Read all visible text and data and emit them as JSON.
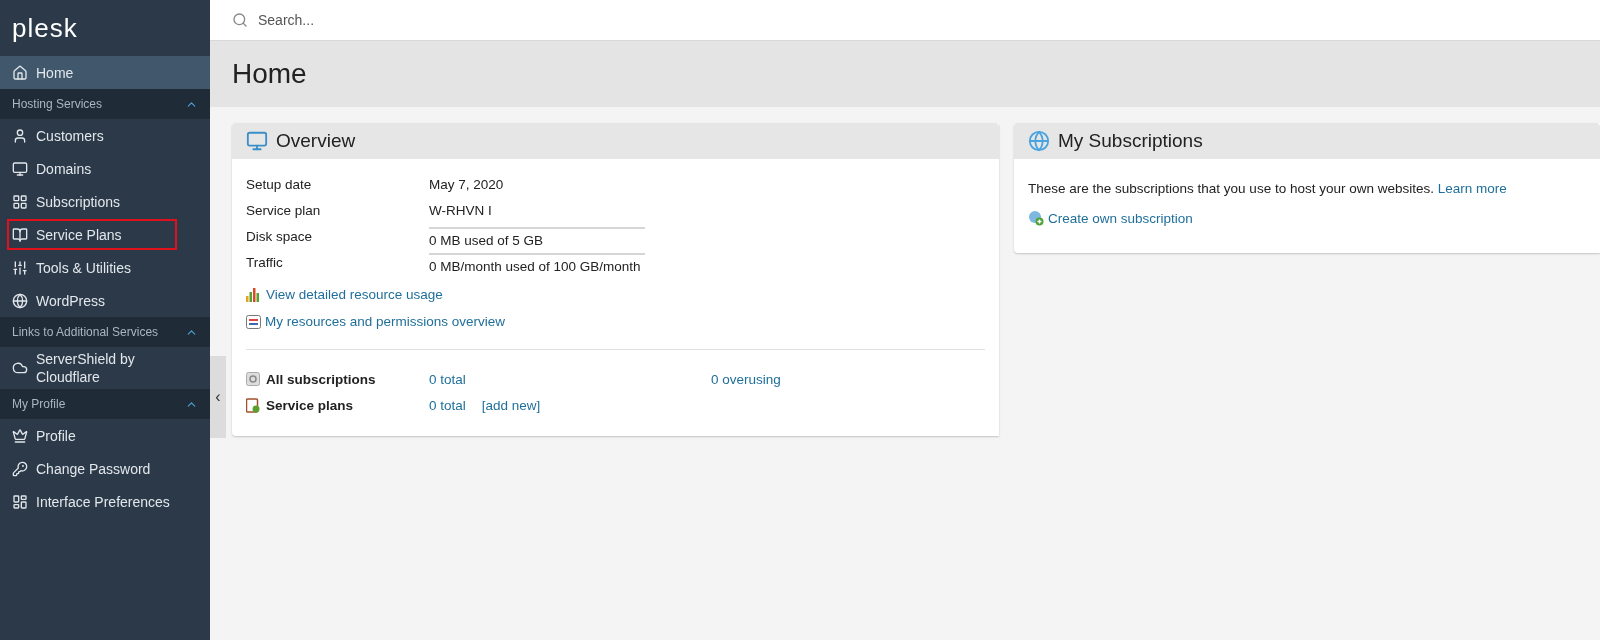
{
  "sidebar": {
    "logo": "plesk",
    "nav": [
      {
        "kind": "link",
        "label": "Home",
        "selected": true,
        "highlighted": false
      },
      {
        "kind": "group",
        "label": "Hosting Services",
        "expanded": true,
        "children": [
          {
            "label": "Customers",
            "selected": false,
            "highlighted": false
          },
          {
            "label": "Domains",
            "selected": false,
            "highlighted": false
          },
          {
            "label": "Subscriptions",
            "selected": false,
            "highlighted": false
          },
          {
            "label": "Service Plans",
            "selected": false,
            "highlighted": true
          },
          {
            "label": "Tools & Utilities",
            "selected": false,
            "highlighted": false
          },
          {
            "label": "WordPress",
            "selected": false,
            "highlighted": false
          }
        ]
      },
      {
        "kind": "group",
        "label": "Links to Additional Services",
        "expanded": true,
        "children": [
          {
            "label": "ServerShield by Cloudflare",
            "selected": false,
            "highlighted": false
          }
        ]
      },
      {
        "kind": "group",
        "label": "My Profile",
        "expanded": true,
        "children": [
          {
            "label": "Profile",
            "selected": false,
            "highlighted": false
          },
          {
            "label": "Change Password",
            "selected": false,
            "highlighted": false
          },
          {
            "label": "Interface Preferences",
            "selected": false,
            "highlighted": false
          }
        ]
      }
    ],
    "collapse_handle": "‹"
  },
  "search": {
    "placeholder": "Search..."
  },
  "page_title": "Home",
  "overview": {
    "title": "Overview",
    "rows": [
      {
        "kind": "text",
        "label": "Setup date",
        "value": "May 7, 2020"
      },
      {
        "kind": "text",
        "label": "Service plan",
        "value": "W-RHVN I"
      },
      {
        "kind": "usage",
        "label": "Disk space",
        "value": "0 MB used of 5 GB",
        "level": 0
      },
      {
        "kind": "usage",
        "label": "Traffic",
        "value": "0 MB/month used of 100 GB/month",
        "level": 0
      }
    ],
    "links": [
      "View detailed resource usage",
      "My resources and permissions overview"
    ],
    "stats": [
      {
        "label": "All subscriptions",
        "total": "0 total",
        "extra": "0 overusing",
        "kind": "spread"
      },
      {
        "label": "Service plans",
        "total": "0 total",
        "extra": "[add new]",
        "kind": "grouped"
      }
    ]
  },
  "subscriptions": {
    "title": "My Subscriptions",
    "text": "These are the subscriptions that you use to host your own websites.",
    "learn_more": "Learn more",
    "create": "Create own subscription"
  }
}
